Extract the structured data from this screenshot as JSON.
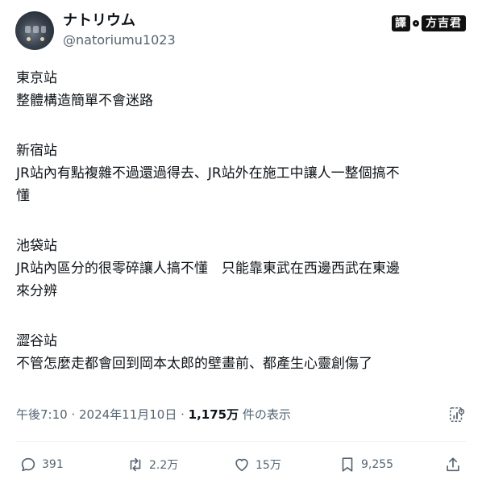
{
  "user": {
    "display_name": "ナトリウム",
    "handle": "@natoriumu1023"
  },
  "badge": {
    "left": "譯",
    "right": "方吉君"
  },
  "post": {
    "lines": [
      "東京站",
      "整體構造簡單不會迷路",
      "",
      "新宿站",
      "JR站內有點複雜不過還過得去、JR站外在施工中讓人一整個搞不",
      "懂",
      "",
      "池袋站",
      "JR站內區分的很零碎讓人搞不懂　只能靠東武在西邊西武在東邊",
      "來分辨",
      "",
      "澀谷站",
      "不管怎麼走都會回到岡本太郎的壁畫前、都產生心靈創傷了"
    ]
  },
  "meta": {
    "time": "午後7:10 · 2024年11月10日 · ",
    "views_count": "1,175万",
    "views_label": " 件の表示"
  },
  "actions": {
    "replies": "391",
    "reposts": "2.2万",
    "likes": "15万",
    "bookmarks": "9,255"
  },
  "icons": {
    "reply": "reply-icon",
    "repost": "repost-icon",
    "like": "heart-icon",
    "bookmark": "bookmark-icon",
    "share": "share-icon",
    "views": "analytics-icon"
  }
}
